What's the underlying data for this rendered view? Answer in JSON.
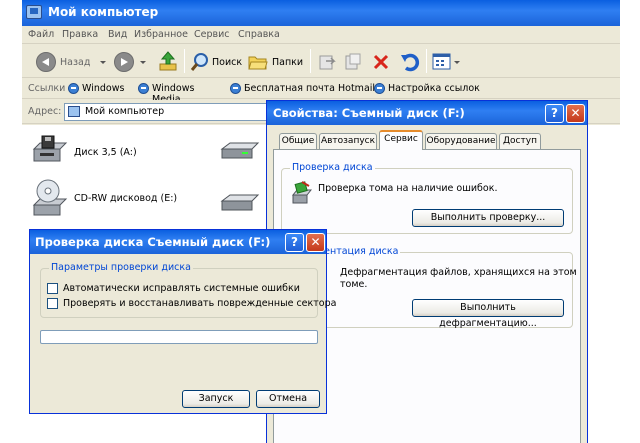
{
  "explorer": {
    "title": "Мой компьютер",
    "menu": [
      "Файл",
      "Правка",
      "Вид",
      "Избранное",
      "Сервис",
      "Справка"
    ],
    "toolbar": {
      "back": "Назад",
      "search": "Поиск",
      "folders": "Папки"
    },
    "links": {
      "label": "Ссылки",
      "items": [
        "Windows",
        "Windows Media",
        "Бесплатная почта Hotmail",
        "Настройка ссылок"
      ]
    },
    "address": {
      "label": "Адрес:",
      "value": "Мой компьютер"
    },
    "drives": [
      {
        "label": "Диск 3,5 (A:)",
        "icon": "floppy-drive-icon"
      },
      {
        "label": "CD-RW дисковод (E:)",
        "icon": "cd-drive-icon"
      }
    ]
  },
  "props": {
    "title": "Свойства: Съемный диск (F:)",
    "tabs": [
      "Общие",
      "Автозапуск",
      "Сервис",
      "Оборудование",
      "Доступ"
    ],
    "active_tab": "Сервис",
    "check_group": {
      "title": "Проверка диска",
      "text": "Проверка тома на наличие ошибок.",
      "button": "Выполнить проверку..."
    },
    "defrag_group": {
      "title": "фрагментация диска",
      "text_line1": "Дефрагментация файлов, хранящихся на этом",
      "text_line2": "томе.",
      "button": "Выполнить дефрагментацию..."
    }
  },
  "chk": {
    "title": "Проверка диска Съемный диск (F:)",
    "group_title": "Параметры проверки диска",
    "options": [
      {
        "label": "Автоматически исправлять системные ошибки",
        "checked": false
      },
      {
        "label": "Проверять и восстанавливать поврежденные сектора",
        "checked": false
      }
    ],
    "progress": 0,
    "start_button": "Запуск",
    "cancel_button": "Отмена"
  },
  "icons": {
    "help": "?",
    "close": "✕"
  },
  "colors": {
    "title_bar": "#1b63d9",
    "tab_highlight": "#e68b2c",
    "group_title": "#0046d5"
  }
}
